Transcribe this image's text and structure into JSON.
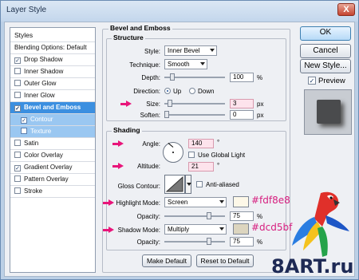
{
  "window": {
    "title": "Layer Style",
    "close_glyph": "X"
  },
  "styles_list": {
    "header": "Styles",
    "items": [
      {
        "label": "Blending Options: Default",
        "checkbox": false,
        "checked": false,
        "state": "normal"
      },
      {
        "label": "Drop Shadow",
        "checkbox": true,
        "checked": true,
        "state": "normal"
      },
      {
        "label": "Inner Shadow",
        "checkbox": true,
        "checked": false,
        "state": "normal"
      },
      {
        "label": "Outer Glow",
        "checkbox": true,
        "checked": false,
        "state": "normal"
      },
      {
        "label": "Inner Glow",
        "checkbox": true,
        "checked": false,
        "state": "normal"
      },
      {
        "label": "Bevel and Emboss",
        "checkbox": true,
        "checked": true,
        "state": "active"
      },
      {
        "label": "Contour",
        "checkbox": true,
        "checked": true,
        "state": "sub"
      },
      {
        "label": "Texture",
        "checkbox": true,
        "checked": false,
        "state": "sub"
      },
      {
        "label": "Satin",
        "checkbox": true,
        "checked": false,
        "state": "normal"
      },
      {
        "label": "Color Overlay",
        "checkbox": true,
        "checked": false,
        "state": "normal"
      },
      {
        "label": "Gradient Overlay",
        "checkbox": true,
        "checked": true,
        "state": "normal"
      },
      {
        "label": "Pattern Overlay",
        "checkbox": true,
        "checked": false,
        "state": "normal"
      },
      {
        "label": "Stroke",
        "checkbox": true,
        "checked": false,
        "state": "normal"
      }
    ]
  },
  "panel": {
    "title": "Bevel and Emboss",
    "structure": {
      "title": "Structure",
      "style": {
        "label": "Style:",
        "value": "Inner Bevel"
      },
      "technique": {
        "label": "Technique:",
        "value": "Smooth"
      },
      "depth": {
        "label": "Depth:",
        "value": "100",
        "unit": "%",
        "level": 0.1
      },
      "direction": {
        "label": "Direction:",
        "up": "Up",
        "down": "Down",
        "selected": "Up"
      },
      "size": {
        "label": "Size:",
        "value": "3",
        "unit": "px",
        "level": 0.05
      },
      "soften": {
        "label": "Soften:",
        "value": "0",
        "unit": "px",
        "level": 0.0
      }
    },
    "shading": {
      "title": "Shading",
      "angle": {
        "label": "Angle:",
        "value": "140",
        "unit": "°"
      },
      "use_global_light": {
        "label": "Use Global Light",
        "checked": false
      },
      "altitude": {
        "label": "Altitude:",
        "value": "21",
        "unit": "°"
      },
      "gloss_contour": {
        "label": "Gloss Contour:"
      },
      "anti_aliased": {
        "label": "Anti-aliased",
        "checked": false
      },
      "highlight_mode": {
        "label": "Highlight Mode:",
        "value": "Screen",
        "color": "#fdf8e8",
        "color_label": "#fdf8e8"
      },
      "highlight_opacity": {
        "label": "Opacity:",
        "value": "75",
        "unit": "%",
        "level": 0.75
      },
      "shadow_mode": {
        "label": "Shadow Mode:",
        "value": "Multiply",
        "color": "#dcd5bf",
        "color_label": "#dcd5bf"
      },
      "shadow_opacity": {
        "label": "Opacity:",
        "value": "75",
        "unit": "%",
        "level": 0.75
      }
    },
    "make_default": "Make Default",
    "reset_to_default": "Reset to Default"
  },
  "buttons": {
    "ok": "OK",
    "cancel": "Cancel",
    "new_style": "New Style...",
    "preview": {
      "label": "Preview",
      "checked": true
    }
  },
  "watermark": "8ART.ru",
  "colors": {
    "accent": "#3b8fe0",
    "annotation": "#e8157a"
  }
}
